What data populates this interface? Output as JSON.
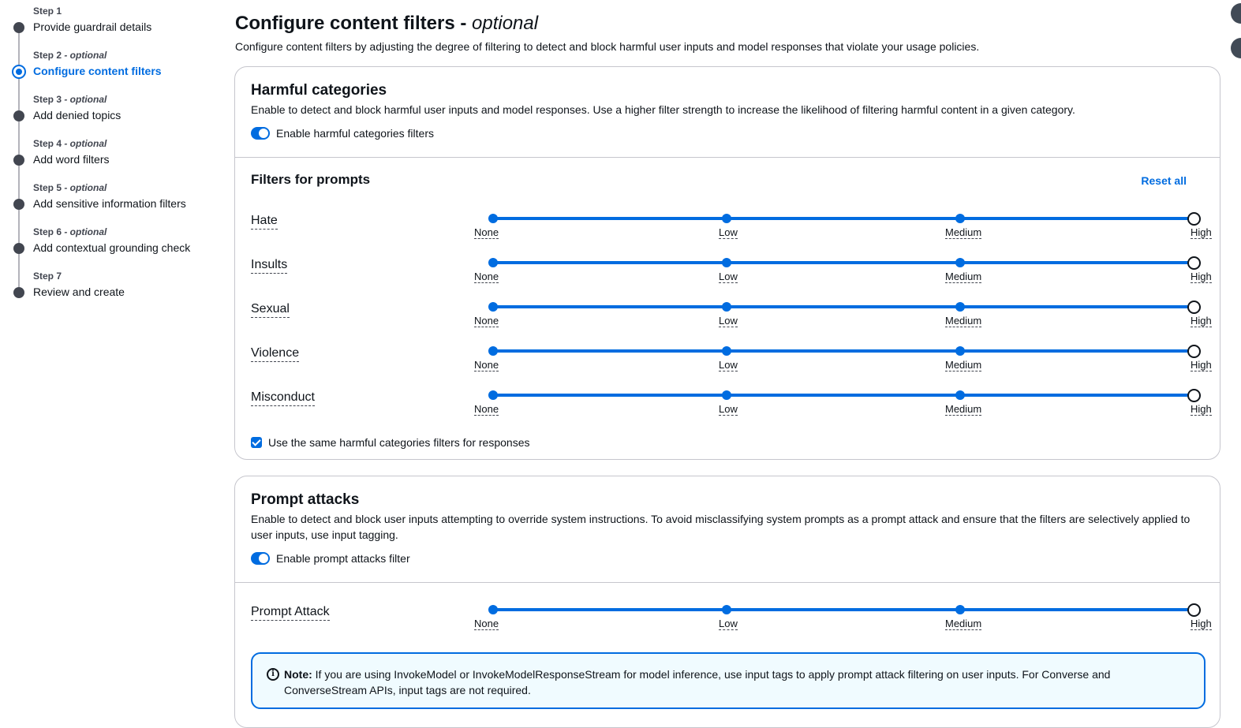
{
  "steps": [
    {
      "num": "Step 1",
      "optional": "",
      "title": "Provide guardrail details"
    },
    {
      "num": "Step 2",
      "optional": " - optional",
      "title": "Configure content filters"
    },
    {
      "num": "Step 3",
      "optional": " - optional",
      "title": "Add denied topics"
    },
    {
      "num": "Step 4",
      "optional": " - optional",
      "title": "Add word filters"
    },
    {
      "num": "Step 5",
      "optional": " - optional",
      "title": "Add sensitive information filters"
    },
    {
      "num": "Step 6",
      "optional": " - optional",
      "title": "Add contextual grounding check"
    },
    {
      "num": "Step 7",
      "optional": "",
      "title": "Review and create"
    }
  ],
  "page": {
    "title": "Configure content filters",
    "title_suffix": "optional",
    "title_dash": " - ",
    "description": "Configure content filters by adjusting the degree of filtering to detect and block harmful user inputs and model responses that violate your usage policies."
  },
  "harmful": {
    "title": "Harmful categories",
    "description": "Enable to detect and block harmful user inputs and model responses. Use a higher filter strength to increase the likelihood of filtering harmful content in a given category.",
    "toggle_label": "Enable harmful categories filters",
    "toggle_on": true,
    "prompts_title": "Filters for prompts",
    "reset_label": "Reset all",
    "levels": [
      "None",
      "Low",
      "Medium",
      "High"
    ],
    "filters": [
      {
        "name": "Hate",
        "level": "High"
      },
      {
        "name": "Insults",
        "level": "High"
      },
      {
        "name": "Sexual",
        "level": "High"
      },
      {
        "name": "Violence",
        "level": "High"
      },
      {
        "name": "Misconduct",
        "level": "High"
      }
    ],
    "same_for_responses_label": "Use the same harmful categories filters for responses",
    "same_for_responses_checked": true
  },
  "prompt_attacks": {
    "title": "Prompt attacks",
    "description": "Enable to detect and block user inputs attempting to override system instructions. To avoid misclassifying system prompts as a prompt attack and ensure that the filters are selectively applied to user inputs, use input tagging.",
    "toggle_label": "Enable prompt attacks filter",
    "toggle_on": true,
    "filter": {
      "name": "Prompt Attack",
      "level": "High"
    },
    "note_label": "Note:",
    "note_text": " If you are using InvokeModel or InvokeModelResponseStream for model inference, use input tags to apply prompt attack filtering on user inputs. For Converse and ConverseStream APIs, input tags are not required."
  },
  "icons": {
    "info": "info-icon"
  },
  "colors": {
    "accent": "#006ce0",
    "text": "#0f141a",
    "border": "#c6c6cd"
  }
}
